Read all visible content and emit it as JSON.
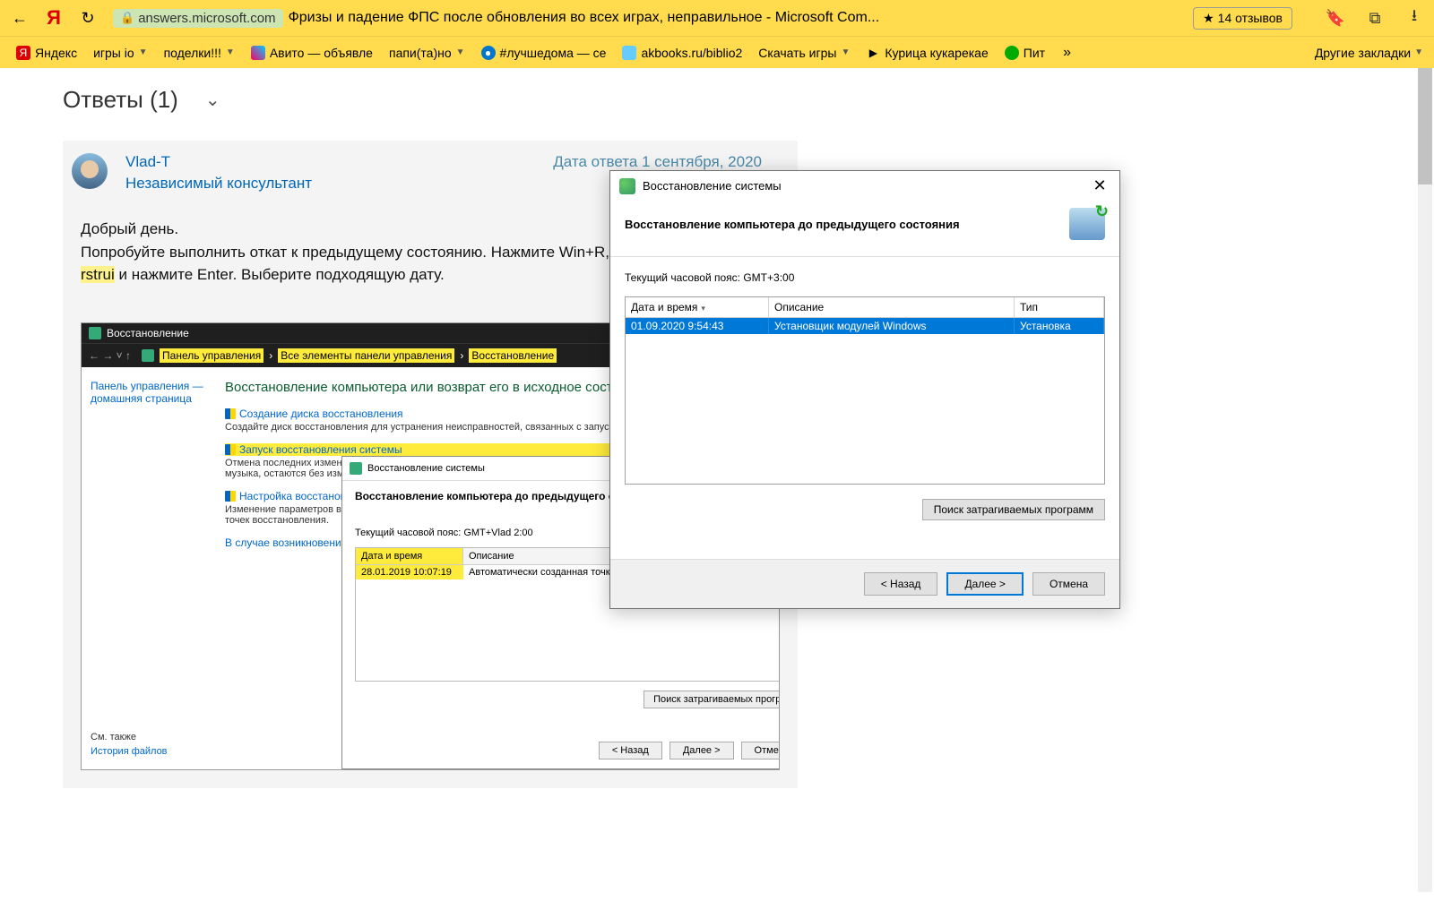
{
  "browser": {
    "url_host": "answers.microsoft.com",
    "page_title": "Фризы и падение ФПС после обновления во всех играх, неправильное - Microsoft Com...",
    "reviews": "14 отзывов",
    "bookmarks": [
      {
        "label": "Яндекс"
      },
      {
        "label": "игры io"
      },
      {
        "label": "поделки!!!"
      },
      {
        "label": "Авито — объявле"
      },
      {
        "label": "папи(та)но"
      },
      {
        "label": "#лучшедома — се"
      },
      {
        "label": "akbooks.ru/biblio2"
      },
      {
        "label": "Скачать игры"
      },
      {
        "label": "Курица кукарекае"
      },
      {
        "label": "Пит"
      }
    ],
    "other_bookmarks": "Другие закладки"
  },
  "page": {
    "answers_header": "Ответы (1)",
    "author": "Vlad-T",
    "role": "Независимый консультант",
    "answer_date": "Дата ответа 1 сентября, 2020",
    "text_line1": "Добрый день.",
    "text_line2a": "Попробуйте выполнить откат к предыдущему состоянию. Нажмите Win+R, введите",
    "text_hl": "rstrui",
    "text_line2b": " и нажмите Enter. Выберите подходящую дату."
  },
  "cp": {
    "window_title": "Восстановление",
    "bc1": "Панель управления",
    "bc2": "Все элементы панели управления",
    "bc3": "Восстановление",
    "side_home": "Панель управления — домашняя страница",
    "side_see_also": "См. также",
    "side_history": "История файлов",
    "heading": "Восстановление компьютера или возврат его в исходное состояние",
    "link1": "Создание диска восстановления",
    "desc1": "Создайте диск восстановления для устранения неисправностей, связанных с запуском ко",
    "link2": "Запуск восстановления системы",
    "desc2": "Отмена последних измене\nмузыка, остаются без изм",
    "link3": "Настройка восстановления",
    "desc3": "Изменение параметров во\nточек восстановления.",
    "link4": "В случае возникновения н\nизменить их."
  },
  "inner": {
    "title": "Восстановление системы",
    "heading": "Восстановление компьютера до предыдущего состоя",
    "tz": "Текущий часовой пояс: GMT+Vlad 2:00",
    "col1": "Дата и время",
    "col2": "Описание",
    "row_date": "28.01.2019 10:07:19",
    "row_desc": "Автоматически созданная точка",
    "search_btn": "Поиск затрагиваемых програм",
    "btn_back": "< Назад",
    "btn_next": "Далее >",
    "btn_cancel": "Отмена"
  },
  "overlay": {
    "title": "Восстановление системы",
    "heading": "Восстановление компьютера до предыдущего состояния",
    "tz": "Текущий часовой пояс: GMT+3:00",
    "col1": "Дата и время",
    "col2": "Описание",
    "col3": "Тип",
    "row_date": "01.09.2020 9:54:43",
    "row_desc": "Установщик модулей Windows",
    "row_type": "Установка",
    "search_btn": "Поиск затрагиваемых программ",
    "btn_back": "< Назад",
    "btn_next": "Далее >",
    "btn_cancel": "Отмена"
  }
}
